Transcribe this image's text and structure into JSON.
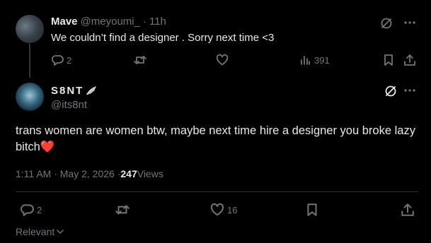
{
  "reply": {
    "display_name": "Mave",
    "handle": "@meyoumi_",
    "separator": "·",
    "time": "11h",
    "text": "We couldn’t find a designer . Sorry next time <3",
    "reply_count": "2",
    "views": "391"
  },
  "main": {
    "display_name": "S8NT",
    "handle": "@its8nt",
    "text": "trans women are women btw, maybe next time hire a designer you broke lazy bitch",
    "emoji": "❤️",
    "timestamp": "1:11 AM · May 2, 2026 · ",
    "view_count": "247",
    "views_label": " Views",
    "reply_count": "2",
    "like_count": "16"
  },
  "footer": {
    "relevant_label": "Relevant"
  },
  "icons": {
    "grok": "grok-icon",
    "more": "more-icon",
    "reply": "reply-icon",
    "repost": "repost-icon",
    "like": "heart-icon",
    "views": "views-icon",
    "bookmark": "bookmark-icon",
    "share": "share-icon"
  },
  "colors": {
    "background": "#000000",
    "text": "#e7e9ea",
    "muted": "#71767b",
    "heart": "#f91880"
  }
}
